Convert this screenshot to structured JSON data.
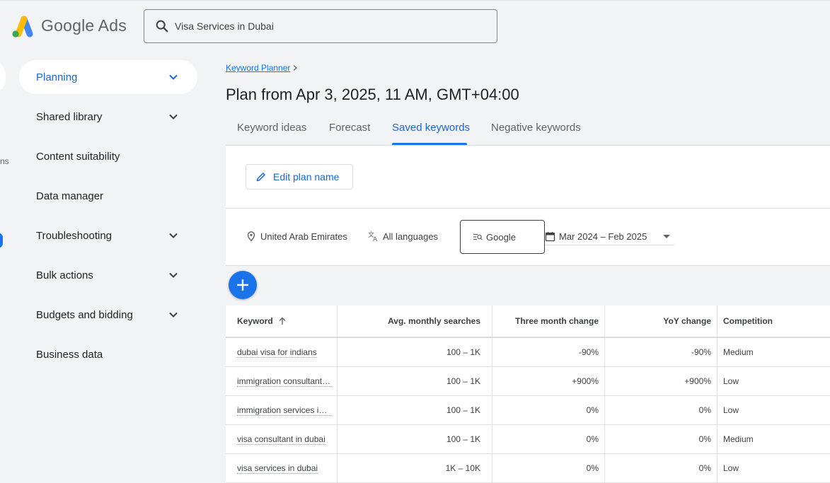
{
  "header": {
    "brand": "Google Ads",
    "search_value": "Visa Services in Dubai",
    "search_icon": "search-icon",
    "logo_colors": {
      "blue": "#4285f4",
      "yellow": "#fbbc04",
      "green": "#34a853"
    }
  },
  "sidebar": {
    "rail_fragment": "ns",
    "items": [
      {
        "label": "Planning",
        "active": true,
        "has_chevron": true
      },
      {
        "label": "Shared library",
        "active": false,
        "has_chevron": true
      },
      {
        "label": "Content suitability",
        "active": false,
        "has_chevron": false
      },
      {
        "label": "Data manager",
        "active": false,
        "has_chevron": false
      },
      {
        "label": "Troubleshooting",
        "active": false,
        "has_chevron": true
      },
      {
        "label": "Bulk actions",
        "active": false,
        "has_chevron": true
      },
      {
        "label": "Budgets and bidding",
        "active": false,
        "has_chevron": true
      },
      {
        "label": "Business data",
        "active": false,
        "has_chevron": false
      }
    ]
  },
  "main": {
    "breadcrumb": "Keyword Planner",
    "title": "Plan from Apr 3, 2025, 11 AM, GMT+04:00",
    "tabs": [
      {
        "label": "Keyword ideas",
        "active": false
      },
      {
        "label": "Forecast",
        "active": false
      },
      {
        "label": "Saved keywords",
        "active": true
      },
      {
        "label": "Negative keywords",
        "active": false
      }
    ],
    "edit_plan_label": "Edit plan name",
    "filters": {
      "location": "United Arab Emirates",
      "language": "All languages",
      "network": "Google",
      "date_range": "Mar 2024 – Feb 2025"
    },
    "accent_color": "#1a73e8"
  },
  "table": {
    "columns": [
      "Keyword",
      "Avg. monthly searches",
      "Three month change",
      "YoY change",
      "Competition"
    ],
    "rows": [
      {
        "keyword": "dubai visa for indians",
        "searches": "100 – 1K",
        "three_month": "-90%",
        "yoy": "-90%",
        "competition": "Medium"
      },
      {
        "keyword": "immigration consultants in dubai",
        "searches": "100 – 1K",
        "three_month": "+900%",
        "yoy": "+900%",
        "competition": "Low"
      },
      {
        "keyword": "immigration services in dubai",
        "searches": "100 – 1K",
        "three_month": "0%",
        "yoy": "0%",
        "competition": "Low"
      },
      {
        "keyword": "visa consultant in dubai",
        "searches": "100 – 1K",
        "three_month": "0%",
        "yoy": "0%",
        "competition": "Medium"
      },
      {
        "keyword": "visa services in dubai",
        "searches": "1K – 10K",
        "three_month": "0%",
        "yoy": "0%",
        "competition": "Low"
      }
    ]
  }
}
